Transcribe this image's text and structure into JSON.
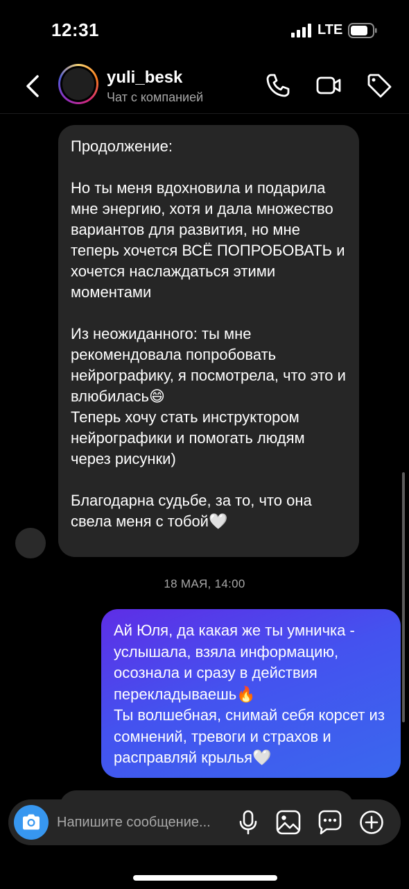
{
  "status_bar": {
    "time": "12:31",
    "network": "LTE"
  },
  "header": {
    "username": "yuli_besk",
    "subtitle": "Чат с компанией",
    "icons": [
      "back-arrow-icon",
      "phone-icon",
      "video-camera-icon",
      "tag-icon"
    ]
  },
  "messages": {
    "incoming": {
      "paragraphs": [
        "Продолжение:",
        "Но ты меня вдохновила и подарила мне энергию, хотя и дала множество вариантов для развития, но мне теперь хочется ВСЁ ПОПРОБОВАТЬ и хочется наслаждаться этими моментами",
        "Из неожиданного: ты мне рекомендовала попробовать нейрографику, я посмотрела, что это и влюбилась😄\nТеперь хочу стать инструктором нейрографики и помогать людям через рисунки)",
        "Благодарна судьбе, за то, что она свела меня с тобой🤍"
      ]
    },
    "date_separator": "18 МАЯ, 14:00",
    "outgoing": {
      "text": "Ай Юля, да какая же ты умничка - услышала, взяла информацию, осознала и сразу в действия перекладываешь🔥\nТы волшебная, снимай себя корсет из сомнений, тревоги и страхов и расправляй крылья🤍"
    }
  },
  "composer": {
    "placeholder": "Напишите сообщение...",
    "icons": [
      "camera-icon",
      "microphone-icon",
      "gallery-icon",
      "sticker-chat-icon",
      "add-icon"
    ]
  },
  "colors": {
    "background": "#000000",
    "incoming_bubble": "#262626",
    "outgoing_gradient_start": "#5e2ee6",
    "outgoing_gradient_end": "#3a68ee",
    "accent": "#3797f0",
    "secondary_text": "#a8a8a8"
  }
}
